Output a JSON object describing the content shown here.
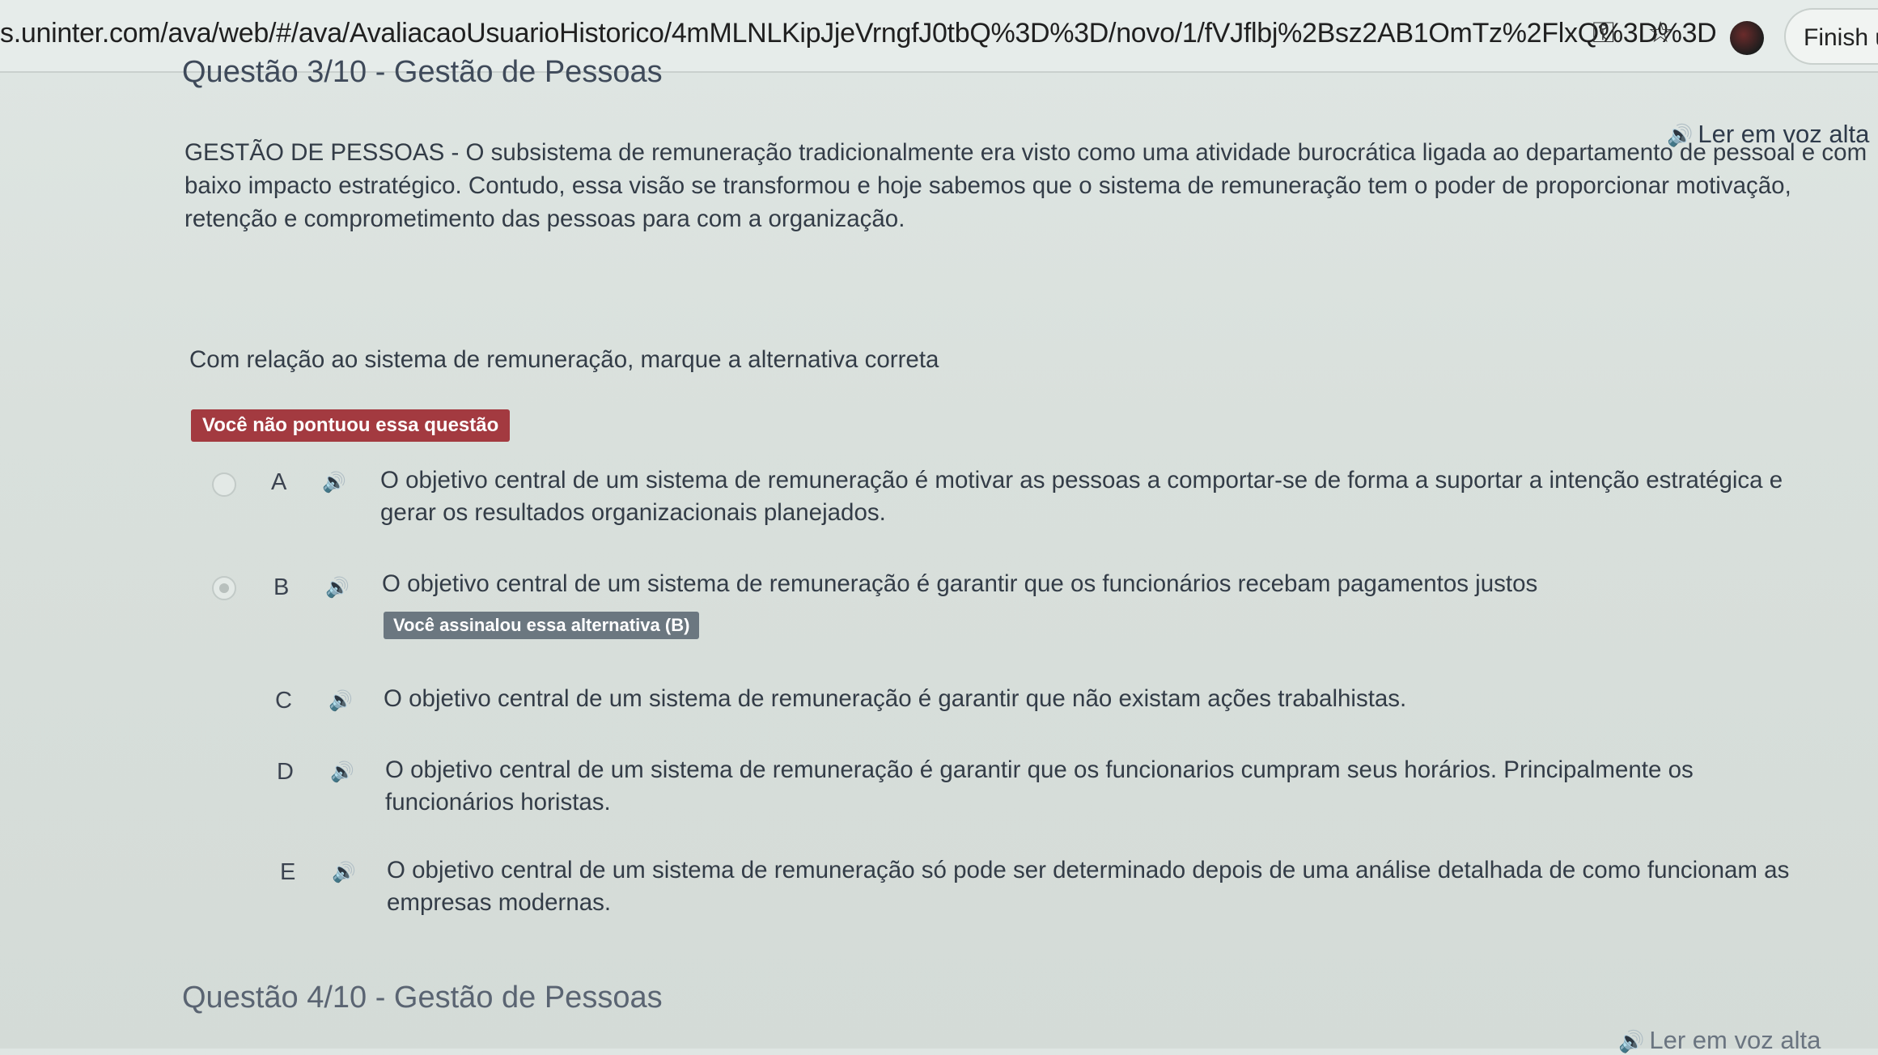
{
  "browser": {
    "url": "s.uninter.com/ava/web/#/ava/AvaliacaoUsuarioHistorico/4mMLNLKipJjeVrngfJ0tbQ%3D%3D/novo/1/fVJflbj%2Bsz2AB1OmTz%2FlxQ%3D%3D",
    "finish_label": "Finish up",
    "icons": [
      "key-icon",
      "star-icon",
      "profile-avatar"
    ]
  },
  "question": {
    "title": "Questão 3/10 - Gestão de Pessoas",
    "read_aloud": "Ler em voz alta",
    "statement": "GESTÃO DE PESSOAS - O subsistema de remuneração tradicionalmente era visto como uma atividade burocrática ligada ao departamento de pessoal e com baixo impacto estratégico. Contudo, essa visão se transformou e hoje sabemos que o sistema de remuneração tem o poder de proporcionar motivação, retenção e comprometimento das pessoas para com a organização.",
    "prompt": "Com relação ao sistema de remuneração, marque a alternativa correta",
    "score_badge": "Você não pontuou essa questão",
    "alternatives": [
      {
        "letter": "A",
        "text": "O objetivo central de um sistema de remuneração é motivar as pessoas a comportar-se de forma a suportar a intenção estratégica e gerar os resultados organizacionais planejados."
      },
      {
        "letter": "B",
        "text": "O objetivo central de um sistema de remuneração é garantir que os funcionários recebam pagamentos justos",
        "selected": true,
        "badge": "Você assinalou essa alternativa (B)"
      },
      {
        "letter": "C",
        "text": "O objetivo central de um sistema de remuneração é garantir que não existam ações trabalhistas."
      },
      {
        "letter": "D",
        "text": "O objetivo central de um sistema de remuneração é garantir que os funcionarios cumpram seus horários. Principalmente os funcionários horistas."
      },
      {
        "letter": "E",
        "text": "O objetivo central de um sistema de remuneração só pode ser determinado depois de uma análise detalhada de como funcionam as empresas modernas."
      }
    ]
  },
  "next_question": {
    "title": "Questão 4/10 - Gestão de Pessoas",
    "read_aloud": "Ler em voz alta"
  },
  "colors": {
    "background": "#d9e0dc",
    "score_badge": "#a33a40",
    "chosen_badge": "#6b7780",
    "text": "#333c47"
  }
}
